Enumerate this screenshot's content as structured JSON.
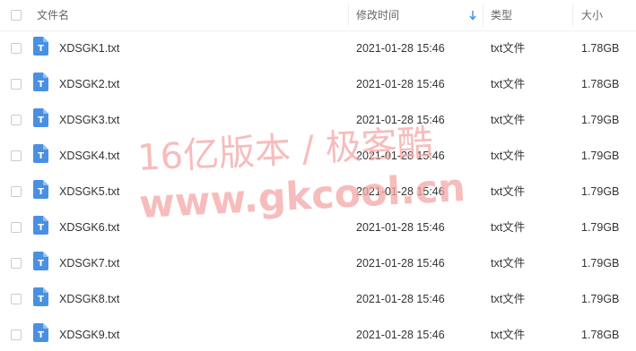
{
  "header": {
    "name_label": "文件名",
    "time_label": "修改时间",
    "type_label": "类型",
    "size_label": "大小",
    "sort_icon": "sort-down-arrow-icon"
  },
  "files": [
    {
      "name": "XDSGK1.txt",
      "modified": "2021-01-28 15:46",
      "type": "txt文件",
      "size": "1.78GB"
    },
    {
      "name": "XDSGK2.txt",
      "modified": "2021-01-28 15:46",
      "type": "txt文件",
      "size": "1.78GB"
    },
    {
      "name": "XDSGK3.txt",
      "modified": "2021-01-28 15:46",
      "type": "txt文件",
      "size": "1.79GB"
    },
    {
      "name": "XDSGK4.txt",
      "modified": "2021-01-28 15:46",
      "type": "txt文件",
      "size": "1.79GB"
    },
    {
      "name": "XDSGK5.txt",
      "modified": "2021-01-28 15:46",
      "type": "txt文件",
      "size": "1.79GB"
    },
    {
      "name": "XDSGK6.txt",
      "modified": "2021-01-28 15:46",
      "type": "txt文件",
      "size": "1.79GB"
    },
    {
      "name": "XDSGK7.txt",
      "modified": "2021-01-28 15:46",
      "type": "txt文件",
      "size": "1.79GB"
    },
    {
      "name": "XDSGK8.txt",
      "modified": "2021-01-28 15:46",
      "type": "txt文件",
      "size": "1.79GB"
    },
    {
      "name": "XDSGK9.txt",
      "modified": "2021-01-28 15:46",
      "type": "txt文件",
      "size": "1.78GB"
    }
  ],
  "file_icon_letter": "T",
  "watermark": {
    "line1": "16亿版本 / 极客酷",
    "line2": "www.gkcool.cn",
    "color": "#f4a6a6"
  },
  "colors": {
    "file_icon": "#4a90e2",
    "sort_icon": "#3b8fe8",
    "text": "#333333",
    "header_text": "#666666"
  }
}
